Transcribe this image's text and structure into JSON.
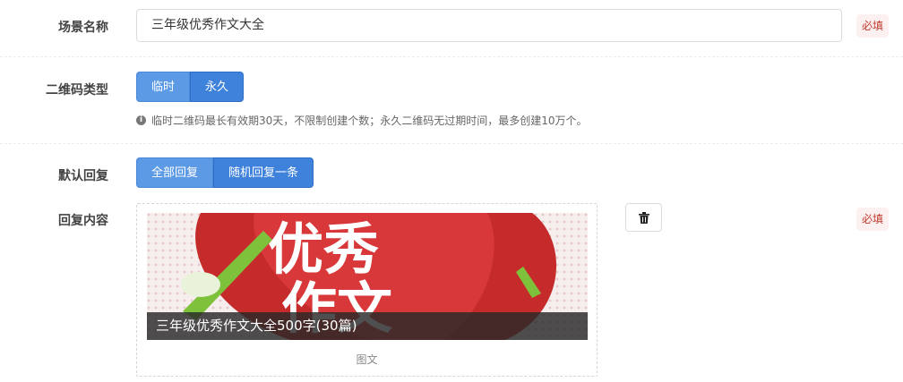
{
  "scene_name": {
    "label": "场景名称",
    "value": "三年级优秀作文大全",
    "required": "必填"
  },
  "qr_type": {
    "label": "二维码类型",
    "options": [
      "临时",
      "永久"
    ],
    "selected": "永久",
    "help": "临时二维码最长有效期30天，不限制创建个数；永久二维码无过期时间，最多创建10万个。"
  },
  "default_reply": {
    "label": "默认回复",
    "options": [
      "全部回复",
      "随机回复一条"
    ],
    "selected": "随机回复一条"
  },
  "reply_content": {
    "label": "回复内容",
    "required": "必填",
    "card": {
      "title": "三年级优秀作文大全500字(30篇)",
      "type": "图文",
      "image_text": [
        "优秀",
        "作文"
      ]
    },
    "delete_icon": "trash-icon"
  },
  "colors": {
    "primary": "#5c9ae6",
    "primary_active": "#3f82dc",
    "required_text": "#c0392b",
    "required_bg": "#fdf0f0"
  }
}
